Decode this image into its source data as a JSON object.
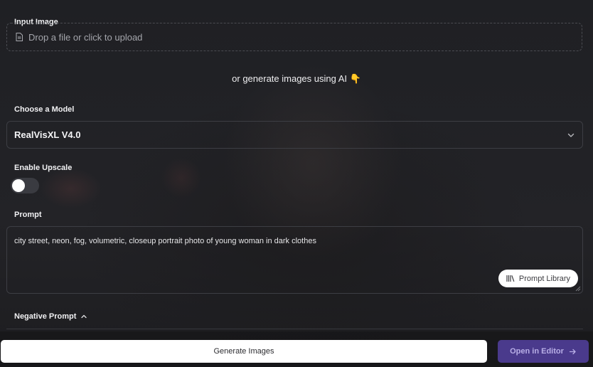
{
  "input_image": {
    "label": "Input Image",
    "upload_text": "Drop a file or click to upload",
    "icon": "file-icon"
  },
  "ai_hint": "or generate images using AI 👇",
  "model": {
    "label": "Choose a Model",
    "selected": "RealVisXL V4.0"
  },
  "upscale": {
    "label": "Enable Upscale",
    "enabled": false
  },
  "prompt": {
    "label": "Prompt",
    "value": "city street, neon, fog, volumetric, closeup portrait photo of young woman in dark clothes",
    "library_button": "Prompt Library"
  },
  "negative_prompt": {
    "label": "Negative Prompt",
    "expanded": true
  },
  "footer": {
    "generate_button": "Generate Images",
    "editor_button": "Open in Editor"
  },
  "colors": {
    "background": "#212226",
    "accent_purple": "#4a3a8c",
    "button_white": "#ffffff"
  }
}
